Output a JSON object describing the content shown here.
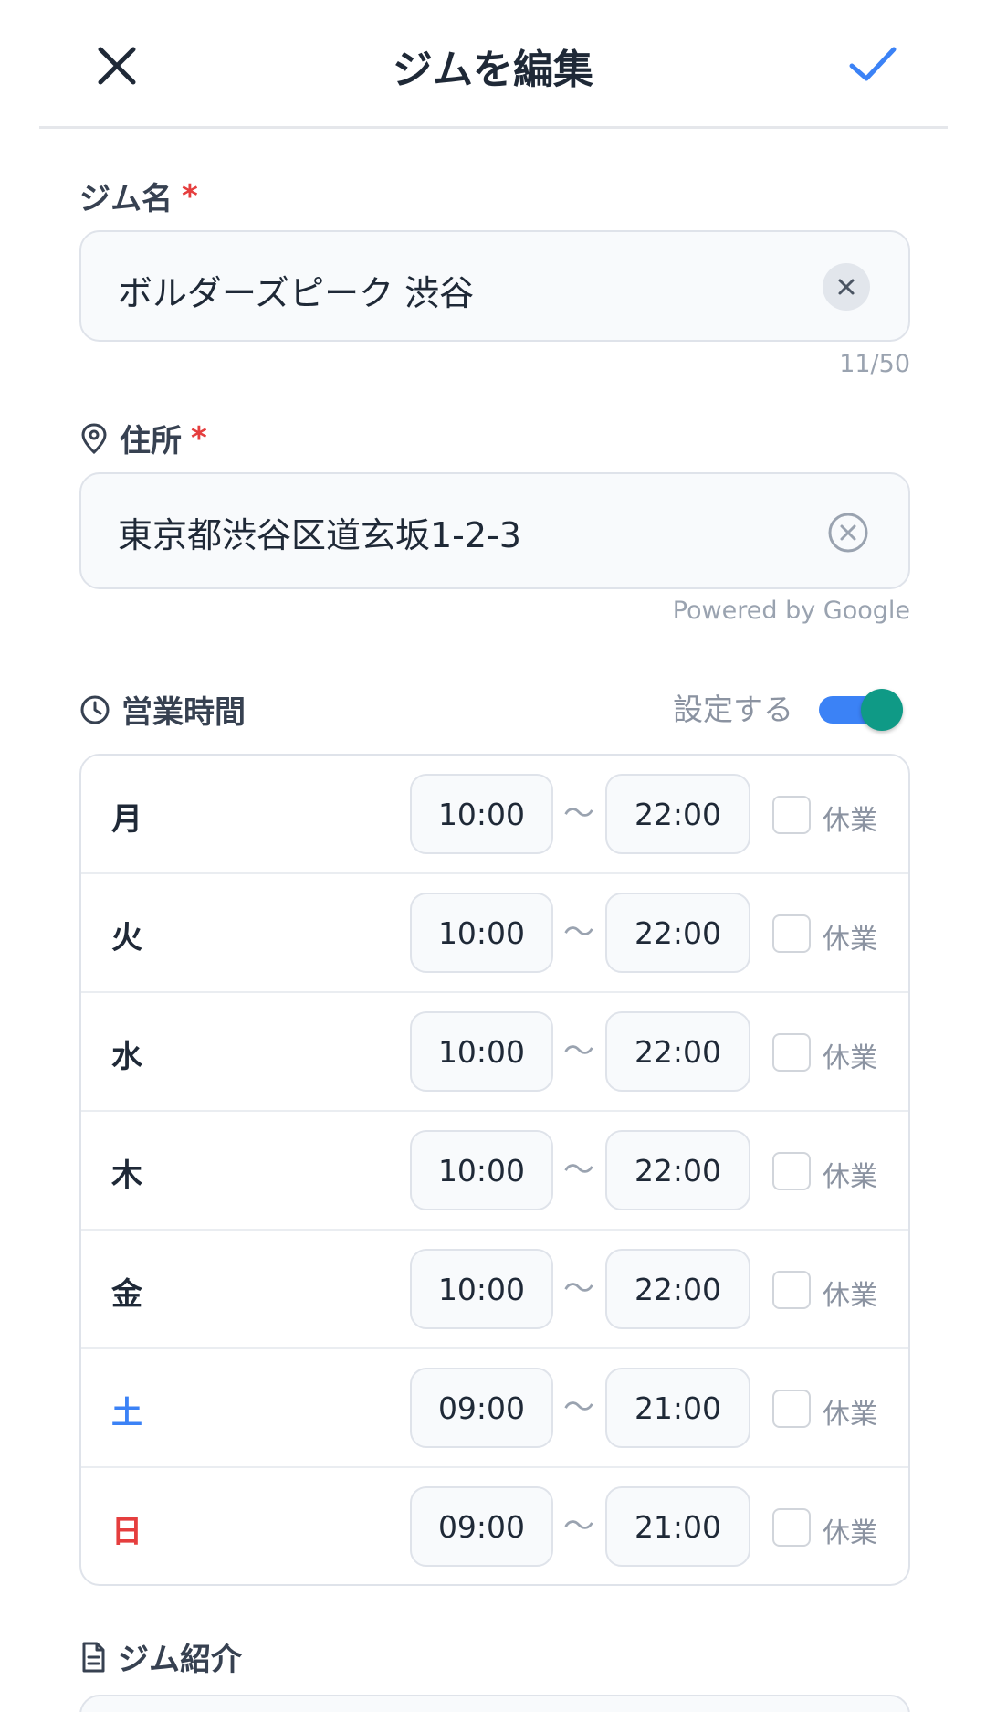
{
  "header": {
    "title": "ジムを編集",
    "close_icon": "close-icon",
    "confirm_icon": "check-icon"
  },
  "gym_name": {
    "label": "ジム名",
    "required_mark": "*",
    "value": "ボルダーズピーク 渋谷",
    "counter": "11/50"
  },
  "address": {
    "label": "住所",
    "required_mark": "*",
    "value": "東京都渋谷区道玄坂1-2-3",
    "attribution": "Powered by Google",
    "icon": "location-pin-icon"
  },
  "hours": {
    "label": "営業時間",
    "icon": "clock-icon",
    "toggle_label": "設定する",
    "toggle_on": true,
    "separator": "〜",
    "closed_label": "休業",
    "days": [
      {
        "day": "月",
        "open": "10:00",
        "close": "22:00",
        "closed": false
      },
      {
        "day": "火",
        "open": "10:00",
        "close": "22:00",
        "closed": false
      },
      {
        "day": "水",
        "open": "10:00",
        "close": "22:00",
        "closed": false
      },
      {
        "day": "木",
        "open": "10:00",
        "close": "22:00",
        "closed": false
      },
      {
        "day": "金",
        "open": "10:00",
        "close": "22:00",
        "closed": false
      },
      {
        "day": "土",
        "open": "09:00",
        "close": "21:00",
        "closed": false
      },
      {
        "day": "日",
        "open": "09:00",
        "close": "21:00",
        "closed": false
      }
    ]
  },
  "intro": {
    "label": "ジム紹介",
    "icon": "document-icon"
  },
  "colors": {
    "accent": "#3b82f6",
    "toggle_knob": "#0f9a86",
    "required": "#e53e3e",
    "saturday": "#3b82f6",
    "sunday": "#e53e3e"
  }
}
